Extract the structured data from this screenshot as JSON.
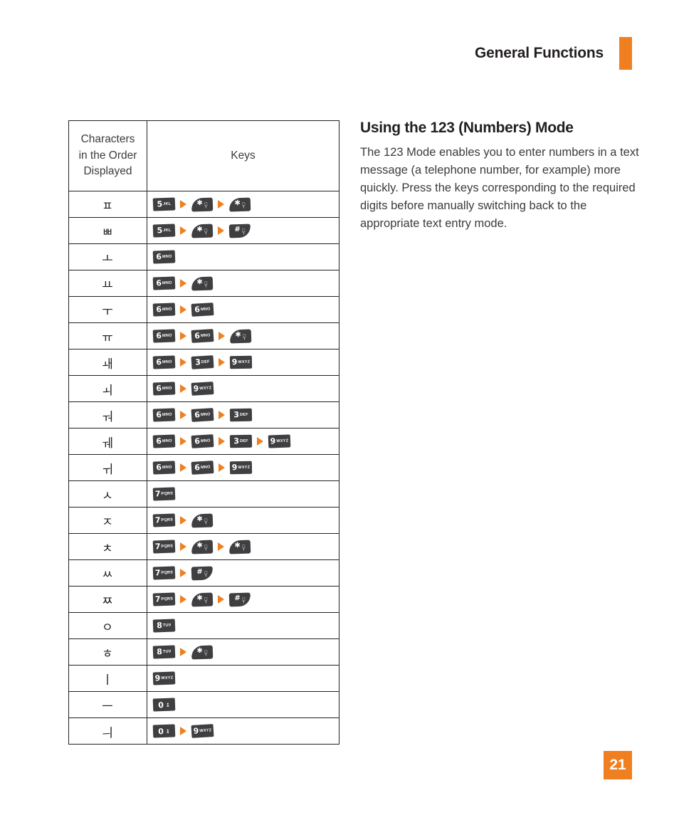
{
  "header": {
    "title": "General Functions",
    "accent_color": "#F07F20"
  },
  "table": {
    "headers": {
      "characters_line1": "Characters",
      "characters_line2": "in the Order",
      "characters_line3": "Displayed",
      "keys": "Keys"
    },
    "rows": [
      {
        "char": "ㅍ",
        "keys": [
          {
            "type": "digit",
            "num": "5",
            "letters": "JKL"
          },
          {
            "type": "star"
          },
          {
            "type": "star"
          }
        ]
      },
      {
        "char": "ㅃ",
        "keys": [
          {
            "type": "digit",
            "num": "5",
            "letters": "JKL"
          },
          {
            "type": "star"
          },
          {
            "type": "hash"
          }
        ]
      },
      {
        "char": "ㅗ",
        "keys": [
          {
            "type": "digit",
            "num": "6",
            "letters": "MNO"
          }
        ]
      },
      {
        "char": "ㅛ",
        "keys": [
          {
            "type": "digit",
            "num": "6",
            "letters": "MNO"
          },
          {
            "type": "star"
          }
        ]
      },
      {
        "char": "ㅜ",
        "keys": [
          {
            "type": "digit",
            "num": "6",
            "letters": "MNO"
          },
          {
            "type": "digit",
            "num": "6",
            "letters": "MNO"
          }
        ]
      },
      {
        "char": "ㅠ",
        "keys": [
          {
            "type": "digit",
            "num": "6",
            "letters": "MNO"
          },
          {
            "type": "digit",
            "num": "6",
            "letters": "MNO"
          },
          {
            "type": "star"
          }
        ]
      },
      {
        "char": "ㅙ",
        "keys": [
          {
            "type": "digit",
            "num": "6",
            "letters": "MNO"
          },
          {
            "type": "digit",
            "num": "3",
            "letters": "DEF"
          },
          {
            "type": "digit",
            "num": "9",
            "letters": "WXYZ"
          }
        ]
      },
      {
        "char": "ㅚ",
        "keys": [
          {
            "type": "digit",
            "num": "6",
            "letters": "MNO"
          },
          {
            "type": "digit",
            "num": "9",
            "letters": "WXYZ"
          }
        ]
      },
      {
        "char": "ㅝ",
        "keys": [
          {
            "type": "digit",
            "num": "6",
            "letters": "MNO"
          },
          {
            "type": "digit",
            "num": "6",
            "letters": "MNO"
          },
          {
            "type": "digit",
            "num": "3",
            "letters": "DEF"
          }
        ]
      },
      {
        "char": "ㅞ",
        "keys": [
          {
            "type": "digit",
            "num": "6",
            "letters": "MNO"
          },
          {
            "type": "digit",
            "num": "6",
            "letters": "MNO"
          },
          {
            "type": "digit",
            "num": "3",
            "letters": "DEF"
          },
          {
            "type": "digit",
            "num": "9",
            "letters": "WXYZ"
          }
        ]
      },
      {
        "char": "ㅟ",
        "keys": [
          {
            "type": "digit",
            "num": "6",
            "letters": "MNO"
          },
          {
            "type": "digit",
            "num": "6",
            "letters": "MNO"
          },
          {
            "type": "digit",
            "num": "9",
            "letters": "WXYZ"
          }
        ]
      },
      {
        "char": "ㅅ",
        "keys": [
          {
            "type": "digit",
            "num": "7",
            "letters": "PQRS"
          }
        ]
      },
      {
        "char": "ㅈ",
        "keys": [
          {
            "type": "digit",
            "num": "7",
            "letters": "PQRS"
          },
          {
            "type": "star"
          }
        ]
      },
      {
        "char": "ㅊ",
        "keys": [
          {
            "type": "digit",
            "num": "7",
            "letters": "PQRS"
          },
          {
            "type": "star"
          },
          {
            "type": "star"
          }
        ]
      },
      {
        "char": "ㅆ",
        "keys": [
          {
            "type": "digit",
            "num": "7",
            "letters": "PQRS"
          },
          {
            "type": "hash"
          }
        ]
      },
      {
        "char": "ㅉ",
        "keys": [
          {
            "type": "digit",
            "num": "7",
            "letters": "PQRS"
          },
          {
            "type": "star"
          },
          {
            "type": "hash"
          }
        ]
      },
      {
        "char": "ㅇ",
        "keys": [
          {
            "type": "digit",
            "num": "8",
            "letters": "TUV"
          }
        ]
      },
      {
        "char": "ㅎ",
        "keys": [
          {
            "type": "digit",
            "num": "8",
            "letters": "TUV"
          },
          {
            "type": "star"
          }
        ]
      },
      {
        "char": "ㅣ",
        "keys": [
          {
            "type": "digit",
            "num": "9",
            "letters": "WXYZ"
          }
        ]
      },
      {
        "char": "ㅡ",
        "keys": [
          {
            "type": "zero",
            "num": "0"
          }
        ]
      },
      {
        "char": "ㅢ",
        "keys": [
          {
            "type": "zero",
            "num": "0"
          },
          {
            "type": "digit",
            "num": "9",
            "letters": "WXYZ"
          }
        ]
      }
    ]
  },
  "article": {
    "heading": "Using the 123 (Numbers) Mode",
    "body": "The 123 Mode enables you to enter numbers in a text message (a telephone number, for example) more quickly. Press the keys corresponding to the required digits before manually switching back to the appropriate text entry mode."
  },
  "footer": {
    "page_number": "21",
    "accent_color": "#F07F20"
  }
}
